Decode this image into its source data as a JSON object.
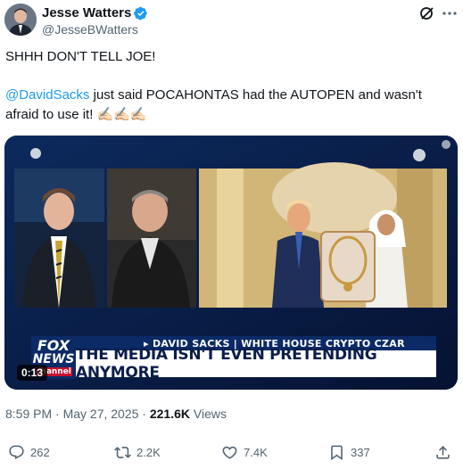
{
  "author": {
    "name": "Jesse Watters",
    "handle": "@JesseBWatters"
  },
  "tweet": {
    "line1": "SHHH DON'T TELL JOE!",
    "mention": "@DavidSacks",
    "line2_rest": " just said POCAHONTAS had the AUTOPEN and wasn't afraid to use it! ✍🏻✍🏻✍🏻"
  },
  "media": {
    "duration": "0:13",
    "chyron_top": "▸ DAVID SACKS | WHITE HOUSE CRYPTO CZAR",
    "chyron_main": "THE MEDIA ISN'T EVEN PRETENDING ANYMORE",
    "logo_line1": "FOX",
    "logo_line2": "NEWS",
    "logo_line3": "channel"
  },
  "meta": {
    "timestamp": "8:59 PM · May 27, 2025 · ",
    "views_count": "221.6K",
    "views_label": " Views"
  },
  "actions": {
    "replies": "262",
    "reposts": "2.2K",
    "likes": "7.4K",
    "bookmarks": "337"
  },
  "colors": {
    "accent": "#1d9bf0",
    "text": "#0f1419",
    "secondary": "#536471",
    "chyron_blue": "#0b2a66"
  },
  "icons": [
    "verified-badge-icon",
    "grok-icon",
    "more-icon",
    "reply-icon",
    "repost-icon",
    "like-icon",
    "bookmark-icon",
    "share-icon"
  ]
}
